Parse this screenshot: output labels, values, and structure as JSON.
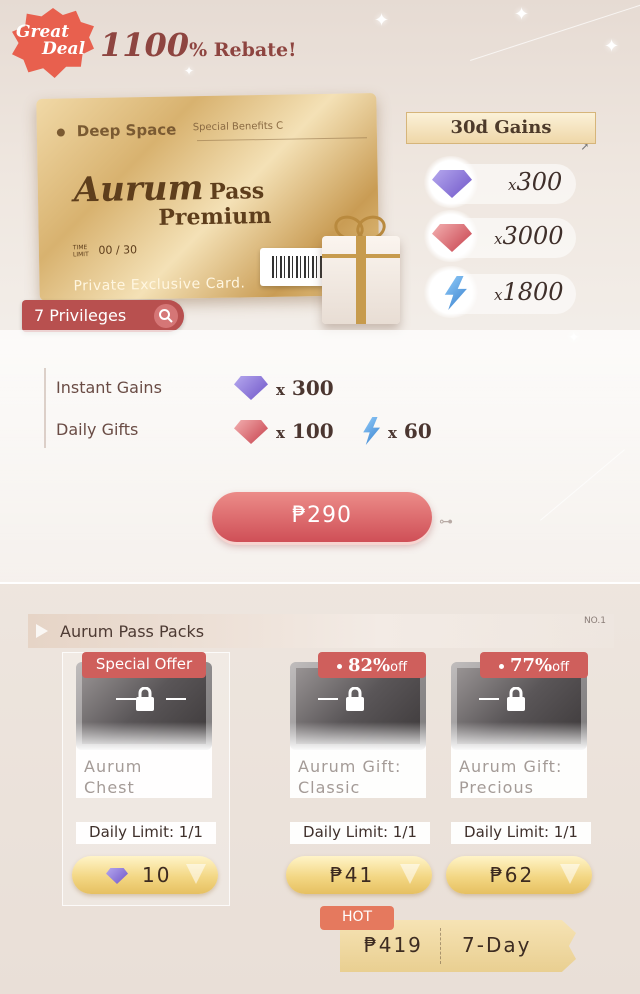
{
  "header": {
    "badge_line1": "Great",
    "badge_line2": "Deal",
    "rebate_number": "1100",
    "rebate_text": "% Rebate!"
  },
  "card": {
    "brand": "Deep Space",
    "benefits": "Special Benefits C",
    "title_main": "Aurum",
    "title_pass": "Pass",
    "title_premium": "Premium",
    "limit_label": "TIME LIMIT",
    "limit_value": "00 / 30",
    "subtitle": "Private Exclusive Card."
  },
  "privileges_button": {
    "label": "7 Privileges",
    "icon": "magnifier-icon"
  },
  "gains": {
    "title": "30d Gains",
    "items": [
      {
        "icon": "purple-diamond-icon",
        "prefix": "x",
        "value": "300"
      },
      {
        "icon": "red-diamond-icon",
        "prefix": "x",
        "value": "3000"
      },
      {
        "icon": "blue-crystal-icon",
        "prefix": "x",
        "value": "1800"
      }
    ]
  },
  "panel": {
    "instant_label": "Instant Gains",
    "instant_prefix": "x",
    "instant_value": "300",
    "daily_label": "Daily Gifts",
    "daily_red_prefix": "x",
    "daily_red_value": "100",
    "daily_blue_prefix": "x",
    "daily_blue_value": "60",
    "price": "₱290"
  },
  "packs": {
    "title": "Aurum Pass Packs",
    "number": "NO.1",
    "items": [
      {
        "tag_text": "Special Offer",
        "name_line1": "Aurum",
        "name_line2": "Chest",
        "limit_label": "Daily Limit:",
        "limit_value": "1/1",
        "price": "10",
        "price_icon": "purple-diamond-icon"
      },
      {
        "tag_pct": "82%",
        "tag_off": "off",
        "name_line1": "Aurum Gift:",
        "name_line2": "Classic",
        "limit_label": "Daily Limit:",
        "limit_value": "1/1",
        "price": "₱41"
      },
      {
        "tag_pct": "77%",
        "tag_off": "off",
        "name_line1": "Aurum Gift:",
        "name_line2": "Precious",
        "limit_label": "Daily Limit:",
        "limit_value": "1/1",
        "price": "₱62"
      }
    ]
  },
  "hot_offer": {
    "tag": "HOT",
    "price": "₱419",
    "duration": "7-Day"
  },
  "colors": {
    "accent_red": "#cf4f57",
    "gold": "#e6c061",
    "hot_orange": "#e5795e"
  }
}
